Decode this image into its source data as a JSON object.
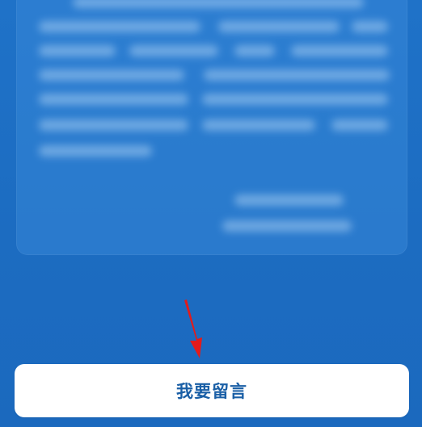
{
  "button": {
    "label": "我要留言"
  },
  "colors": {
    "background": "#1d6fc4",
    "card": "#3c8cdc",
    "button_bg": "#ffffff",
    "button_text": "#1a5fa6",
    "arrow": "#e31b1b"
  },
  "icons": {
    "arrow": "red-annotation-arrow-icon",
    "watermark": "baidu-jingyan-watermark-icon"
  }
}
